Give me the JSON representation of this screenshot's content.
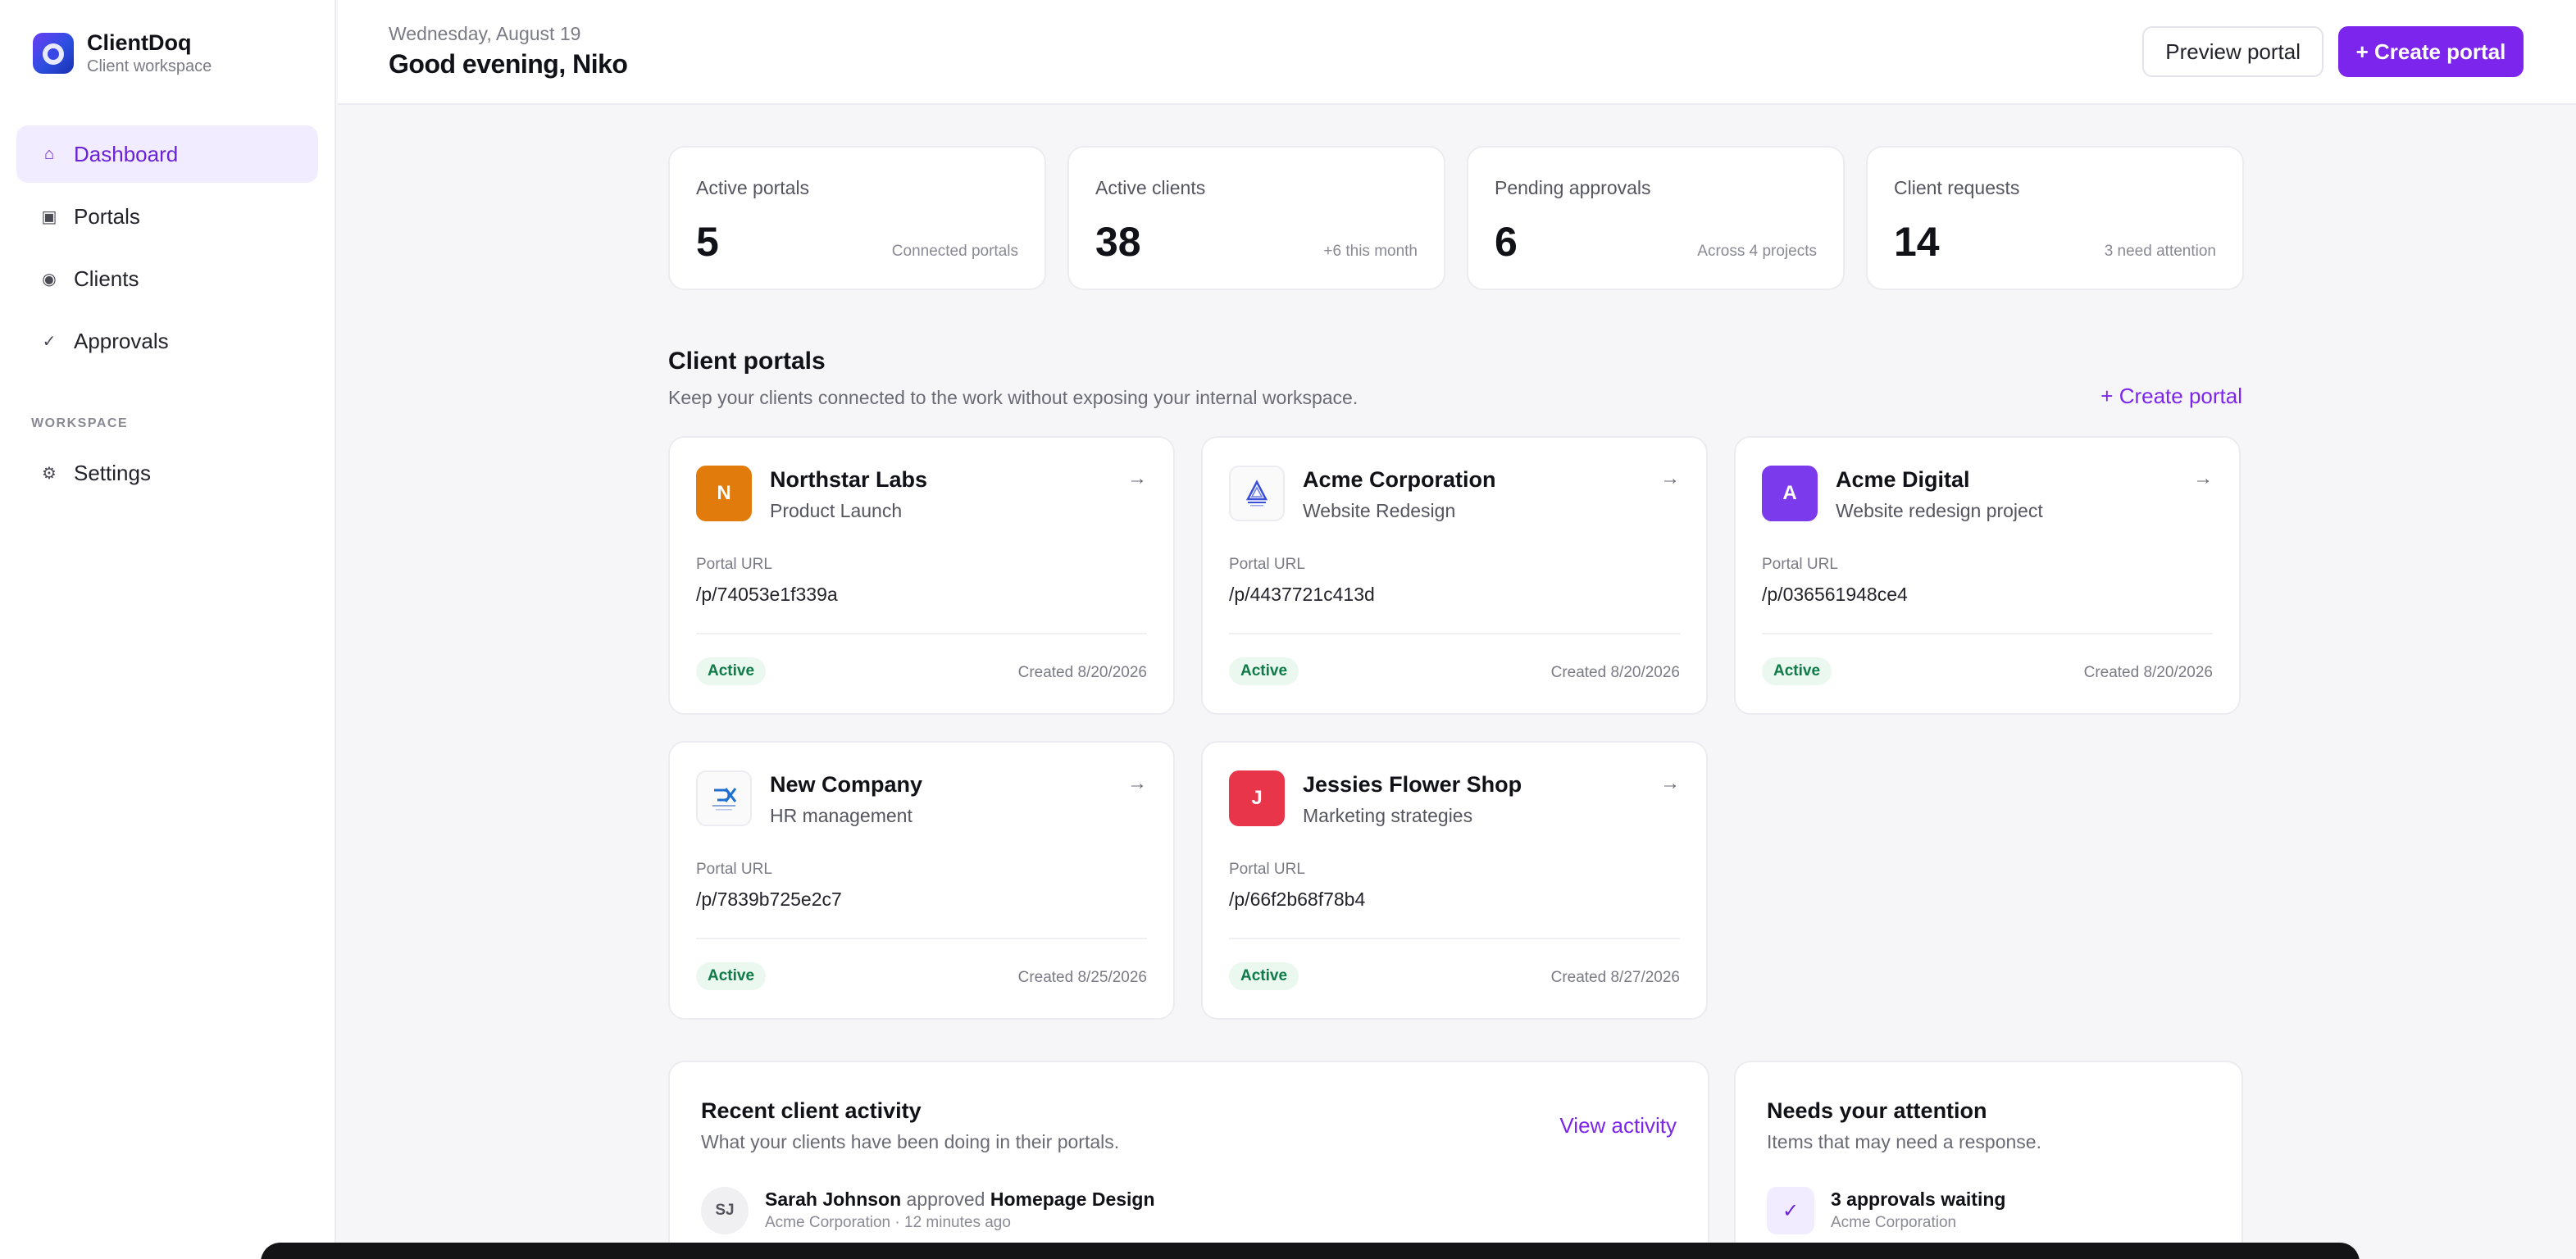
{
  "brand": {
    "name": "ClientDoq",
    "subtitle": "Client workspace"
  },
  "nav": {
    "items": [
      {
        "label": "Dashboard",
        "icon": "home-icon",
        "glyph": "⌂"
      },
      {
        "label": "Portals",
        "icon": "square-icon",
        "glyph": "▣"
      },
      {
        "label": "Clients",
        "icon": "circle-icon",
        "glyph": "◉"
      },
      {
        "label": "Approvals",
        "icon": "check-icon",
        "glyph": "✓"
      }
    ],
    "section_label": "WORKSPACE",
    "settings": {
      "label": "Settings",
      "icon": "gear-icon",
      "glyph": "⚙"
    }
  },
  "header": {
    "date": "Wednesday, August 19",
    "greeting": "Good evening, Niko",
    "preview_label": "Preview portal",
    "create_label": "+ Create portal"
  },
  "stats": [
    {
      "label": "Active portals",
      "value": "5",
      "note": "Connected portals"
    },
    {
      "label": "Active clients",
      "value": "38",
      "note": "+6 this month"
    },
    {
      "label": "Pending approvals",
      "value": "6",
      "note": "Across 4 projects"
    },
    {
      "label": "Client requests",
      "value": "14",
      "note": "3 need attention"
    }
  ],
  "portals_section": {
    "title": "Client portals",
    "subtitle": "Keep your clients connected to the work without exposing your internal workspace.",
    "link": "+ Create portal",
    "url_label": "Portal URL",
    "arrow": "→",
    "cards": [
      {
        "initial": "N",
        "avatar_color": "#e07b0c",
        "name": "Northstar Labs",
        "desc": "Product Launch",
        "url": "/p/74053e1f339a",
        "status": "Active",
        "created": "Created 8/20/2026"
      },
      {
        "initial": "",
        "avatar_color": "logo",
        "name": "Acme Corporation",
        "desc": "Website Redesign",
        "url": "/p/4437721c413d",
        "status": "Active",
        "created": "Created 8/20/2026"
      },
      {
        "initial": "A",
        "avatar_color": "#7c3aed",
        "name": "Acme Digital",
        "desc": "Website redesign project",
        "url": "/p/036561948ce4",
        "status": "Active",
        "created": "Created 8/20/2026"
      },
      {
        "initial": "",
        "avatar_color": "logo",
        "name": "New Company",
        "desc": "HR management",
        "url": "/p/7839b725e2c7",
        "status": "Active",
        "created": "Created 8/25/2026"
      },
      {
        "initial": "J",
        "avatar_color": "#e8354a",
        "name": "Jessies Flower Shop",
        "desc": "Marketing strategies",
        "url": "/p/66f2b68f78b4",
        "status": "Active",
        "created": "Created 8/27/2026"
      }
    ]
  },
  "activity": {
    "title": "Recent client activity",
    "subtitle": "What your clients have been doing in their portals.",
    "link": "View activity",
    "items": [
      {
        "initials": "SJ",
        "actor": "Sarah Johnson",
        "verb": " approved ",
        "object": "Homepage Design",
        "meta": "Acme Corporation · 12 minutes ago"
      }
    ]
  },
  "attention": {
    "title": "Needs your attention",
    "subtitle": "Items that may need a response.",
    "items": [
      {
        "glyph": "✓",
        "title": "3 approvals waiting",
        "meta": "Acme Corporation"
      }
    ]
  },
  "colors": {
    "accent": "#7c25ec",
    "active_badge_bg": "#eaf8f0",
    "active_badge_text": "#0f7a48"
  }
}
